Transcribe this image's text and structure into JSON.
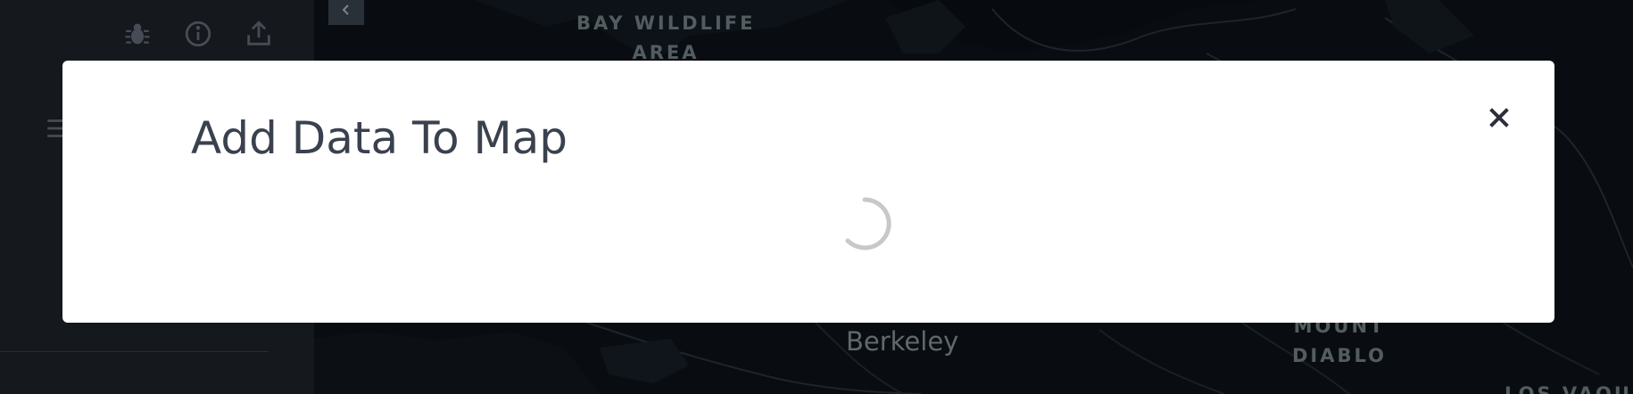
{
  "modal": {
    "title": "Add Data To Map",
    "close_icon": "close-icon",
    "loading_icon": "loading-spinner-icon"
  },
  "sidebar": {
    "icons": [
      "bug-icon",
      "info-icon",
      "share-icon",
      "settings-sliders-icon"
    ],
    "collapse_icon": "chevron-left-icon"
  },
  "map": {
    "labels": {
      "wildlife_line1": "BAY WILDLIFE",
      "wildlife_line2": "AREA",
      "berkeley": "Berkeley",
      "diablo_line1": "MOUNT",
      "diablo_line2": "DIABLO",
      "los_vaqueros": "LOS VAQUE"
    }
  },
  "colors": {
    "modal_bg": "#ffffff",
    "title_text": "#3a414e",
    "sidebar_bg": "#1c2026",
    "map_bg": "#0d1218",
    "spinner": "#c8c8c8"
  }
}
